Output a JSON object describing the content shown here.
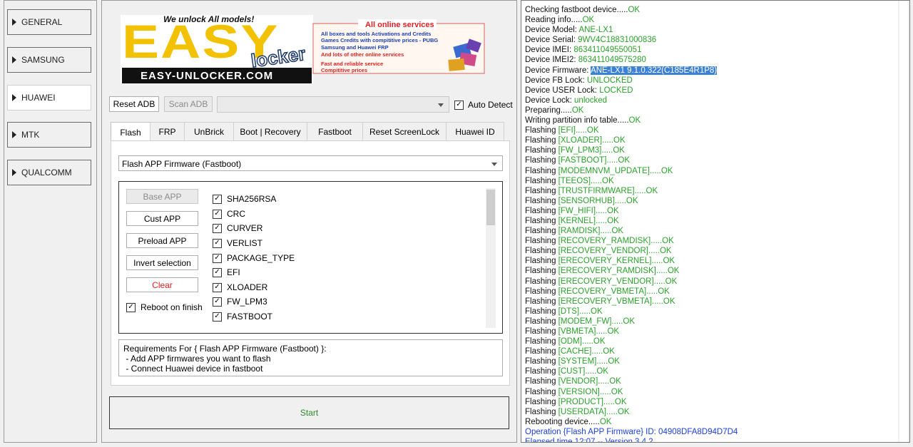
{
  "sidebar": {
    "items": [
      {
        "label": "GENERAL"
      },
      {
        "label": "SAMSUNG"
      },
      {
        "label": "HUAWEI"
      },
      {
        "label": "MTK"
      },
      {
        "label": "QUALCOMM"
      }
    ]
  },
  "banner": {
    "tagline": "We unlock All models!",
    "logo_easy": "EASY",
    "logo_locker": "locker",
    "site": "EASY-UNLOCKER.COM",
    "online_title": "All online services",
    "online_lines": [
      "All boxes and tools Activations and Credits",
      "Games Credits with compititive prices - PUBG",
      "Samsung and Huawei FRP",
      "And lots of other online services",
      "Fast and reliable service",
      "Compititive prices"
    ]
  },
  "toolbar": {
    "reset_adb": "Reset ADB",
    "scan_adb": "Scan ADB",
    "port_value": "",
    "auto_detect": "Auto Detect",
    "auto_detect_checked": true
  },
  "tabs": [
    {
      "label": "Flash"
    },
    {
      "label": "FRP"
    },
    {
      "label": "UnBrick"
    },
    {
      "label": "Boot | Recovery"
    },
    {
      "label": "Fastboot"
    },
    {
      "label": "Reset ScreenLock"
    },
    {
      "label": "Huawei ID"
    }
  ],
  "flash": {
    "mode": "Flash APP Firmware (Fastboot)",
    "buttons": {
      "base_app": "Base APP",
      "cust_app": "Cust APP",
      "preload_app": "Preload APP",
      "invert_selection": "Invert selection",
      "clear": "Clear"
    },
    "reboot_on_finish": "Reboot on finish",
    "partitions": [
      "SHA256RSA",
      "CRC",
      "CURVER",
      "VERLIST",
      "PACKAGE_TYPE",
      "EFI",
      "XLOADER",
      "FW_LPM3",
      "FASTBOOT"
    ],
    "requirements": [
      "Requirements For { Flash APP Firmware (Fastboot) }:",
      " - Add APP firmwares you want to flash",
      " - Connect Huawei device in fastboot"
    ],
    "start": "Start"
  },
  "log": [
    {
      "t": "Checking fastboot device.....",
      "v": "OK"
    },
    {
      "t": "Reading info.....",
      "v": "OK"
    },
    {
      "t": "Device Model: ",
      "v": "ANE-LX1"
    },
    {
      "t": "Device Serial: ",
      "v": "9WV4C18831000836"
    },
    {
      "t": "Device IMEI: ",
      "v": "863411049550051"
    },
    {
      "t": "Device IMEI2: ",
      "v": "863411049575280"
    },
    {
      "t": "Device Firmware: ",
      "v": "ANE-LX1 9.1.0.322(C185E4R1P8)"
    },
    {
      "t": "Device FB Lock: ",
      "v": "UNLOCKED"
    },
    {
      "t": "Device USER Lock: ",
      "v": "LOCKED"
    },
    {
      "t": "Device Lock: ",
      "v": "unlocked"
    },
    {
      "t": "Preparing.....",
      "v": "OK"
    },
    {
      "t": "Writing partition info table.....",
      "v": "OK"
    },
    {
      "t": "Flashing ",
      "p": "[EFI]",
      "v": ".....OK"
    },
    {
      "t": "Flashing ",
      "p": "[XLOADER]",
      "v": ".....OK"
    },
    {
      "t": "Flashing ",
      "p": "[FW_LPM3]",
      "v": ".....OK"
    },
    {
      "t": "Flashing ",
      "p": "[FASTBOOT]",
      "v": ".....OK"
    },
    {
      "t": "Flashing ",
      "p": "[MODEMNVM_UPDATE]",
      "v": ".....OK"
    },
    {
      "t": "Flashing ",
      "p": "[TEEOS]",
      "v": ".....OK"
    },
    {
      "t": "Flashing ",
      "p": "[TRUSTFIRMWARE]",
      "v": ".....OK"
    },
    {
      "t": "Flashing ",
      "p": "[SENSORHUB]",
      "v": ".....OK"
    },
    {
      "t": "Flashing ",
      "p": "[FW_HIFI]",
      "v": ".....OK"
    },
    {
      "t": "Flashing ",
      "p": "[KERNEL]",
      "v": ".....OK"
    },
    {
      "t": "Flashing ",
      "p": "[RAMDISK]",
      "v": ".....OK"
    },
    {
      "t": "Flashing ",
      "p": "[RECOVERY_RAMDISK]",
      "v": ".....OK"
    },
    {
      "t": "Flashing ",
      "p": "[RECOVERY_VENDOR]",
      "v": ".....OK"
    },
    {
      "t": "Flashing ",
      "p": "[ERECOVERY_KERNEL]",
      "v": ".....OK"
    },
    {
      "t": "Flashing ",
      "p": "[ERECOVERY_RAMDISK]",
      "v": ".....OK"
    },
    {
      "t": "Flashing ",
      "p": "[ERECOVERY_VENDOR]",
      "v": ".....OK"
    },
    {
      "t": "Flashing ",
      "p": "[RECOVERY_VBMETA]",
      "v": ".....OK"
    },
    {
      "t": "Flashing ",
      "p": "[ERECOVERY_VBMETA]",
      "v": ".....OK"
    },
    {
      "t": "Flashing ",
      "p": "[DTS]",
      "v": ".....OK"
    },
    {
      "t": "Flashing ",
      "p": "[MODEM_FW]",
      "v": ".....OK"
    },
    {
      "t": "Flashing ",
      "p": "[VBMETA]",
      "v": ".....OK"
    },
    {
      "t": "Flashing ",
      "p": "[ODM]",
      "v": ".....OK"
    },
    {
      "t": "Flashing ",
      "p": "[CACHE]",
      "v": ".....OK"
    },
    {
      "t": "Flashing ",
      "p": "[SYSTEM]",
      "v": ".....OK"
    },
    {
      "t": "Flashing ",
      "p": "[CUST]",
      "v": ".....OK"
    },
    {
      "t": "Flashing ",
      "p": "[VENDOR]",
      "v": ".....OK"
    },
    {
      "t": "Flashing ",
      "p": "[VERSION]",
      "v": ".....OK"
    },
    {
      "t": "Flashing ",
      "p": "[PRODUCT]",
      "v": ".....OK"
    },
    {
      "t": "Flashing ",
      "p": "[USERDATA]",
      "v": ".....OK"
    },
    {
      "t": "Rebooting device.....",
      "v": "OK"
    },
    {
      "b": "Operation {Flash APP Firmware} ID: 04908DFA8D94D7D4"
    },
    {
      "b": "Elapsed time 12:07 -- Version 3.4.2"
    }
  ],
  "colors": {
    "ok": "#2aa02a",
    "info": "#1a3fd6",
    "highlight": "#3b82d6",
    "clear": "#e02020",
    "start": "#2a8a2a"
  }
}
